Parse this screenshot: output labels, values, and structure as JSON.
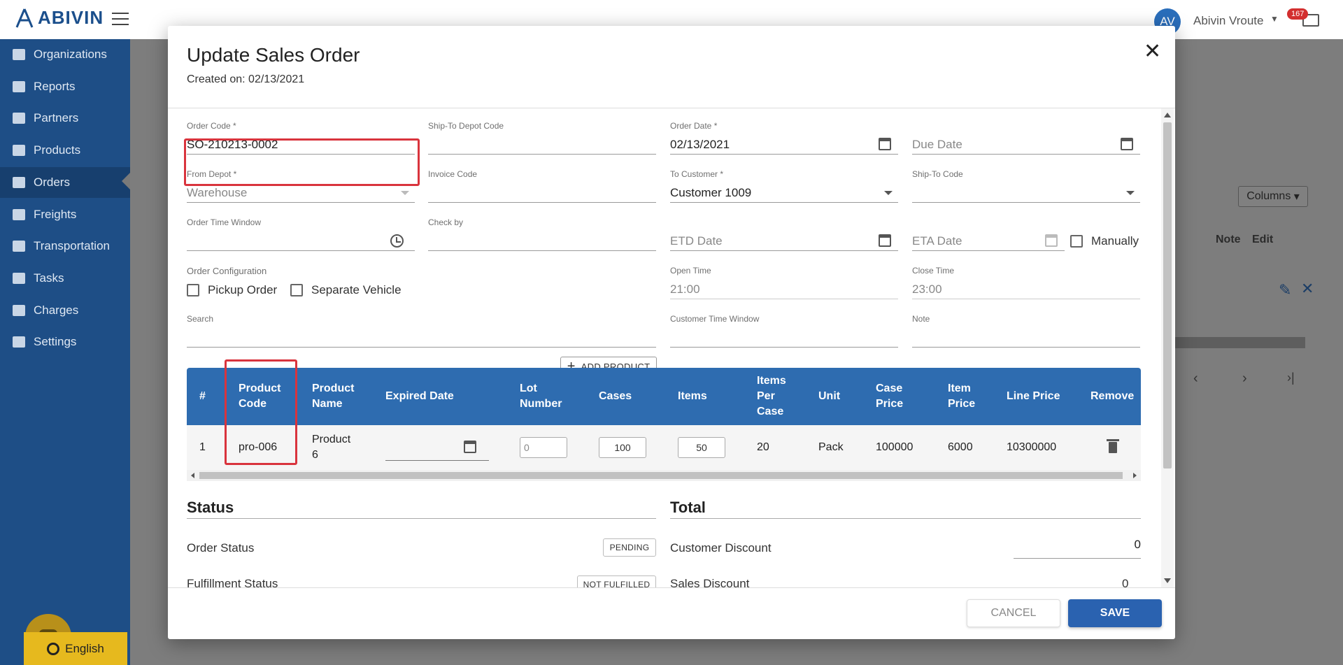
{
  "app": {
    "logo_text": "ABIVIN",
    "user_initials": "AV",
    "user_name": "Abivin Vroute",
    "notification_count": "167",
    "language": "English"
  },
  "sidebar": {
    "items": [
      {
        "label": "Organizations",
        "icon": "home-icon"
      },
      {
        "label": "Reports",
        "icon": "bar-chart-icon"
      },
      {
        "label": "Partners",
        "icon": "users-icon"
      },
      {
        "label": "Products",
        "icon": "boxes-icon"
      },
      {
        "label": "Orders",
        "icon": "cubes-icon",
        "active": true
      },
      {
        "label": "Freights",
        "icon": "truck-icon"
      },
      {
        "label": "Transportation",
        "icon": "road-icon"
      },
      {
        "label": "Tasks",
        "icon": "calendar-icon"
      },
      {
        "label": "Charges",
        "icon": "hand-coin-icon"
      },
      {
        "label": "Settings",
        "icon": "gear-icon"
      }
    ]
  },
  "background": {
    "columns_button": "Columns",
    "col_note": "Note",
    "col_edit": "Edit"
  },
  "modal": {
    "title": "Update Sales Order",
    "created_on": "Created on: 02/13/2021",
    "fields": {
      "order_code": {
        "label": "Order Code *",
        "value": "SO-210213-0002"
      },
      "ship_to_depot_code": {
        "label": "Ship-To Depot Code",
        "value": ""
      },
      "order_date": {
        "label": "Order Date *",
        "value": "02/13/2021"
      },
      "due_date": {
        "label": "",
        "placeholder": "Due Date"
      },
      "from_depot": {
        "label": "From Depot *",
        "value": "Warehouse"
      },
      "invoice_code": {
        "label": "Invoice Code",
        "value": ""
      },
      "to_customer": {
        "label": "To Customer *",
        "value": "Customer 1009"
      },
      "ship_to_code": {
        "label": "Ship-To Code",
        "value": ""
      },
      "order_time_window": {
        "label": "Order Time Window",
        "value": ""
      },
      "check_by": {
        "label": "Check by",
        "value": ""
      },
      "etd_date": {
        "label": "",
        "placeholder": "ETD Date"
      },
      "eta_date": {
        "label": "",
        "placeholder": "ETA Date"
      },
      "manually": "Manually",
      "order_configuration": "Order Configuration",
      "pickup_order": "Pickup Order",
      "separate_vehicle": "Separate Vehicle",
      "open_time": {
        "label": "Open Time",
        "value": "21:00"
      },
      "close_time": {
        "label": "Close Time",
        "value": "23:00"
      },
      "search": {
        "label": "Search",
        "value": ""
      },
      "add_product": "ADD PRODUCT",
      "customer_time_window": {
        "label": "Customer Time Window",
        "value": ""
      },
      "note": {
        "label": "Note",
        "value": ""
      }
    },
    "table": {
      "headers": {
        "num": "#",
        "product_code": [
          "Product",
          "Code"
        ],
        "product_name": [
          "Product",
          "Name"
        ],
        "expired_date": "Expired Date",
        "lot_number": [
          "Lot",
          "Number"
        ],
        "cases": "Cases",
        "items": "Items",
        "items_per_case": [
          "Items",
          "Per",
          "Case"
        ],
        "unit": "Unit",
        "case_price": [
          "Case",
          "Price"
        ],
        "item_price": [
          "Item",
          "Price"
        ],
        "line_price": "Line Price",
        "remove": "Remove"
      },
      "rows": [
        {
          "num": "1",
          "product_code": "pro-006",
          "product_name": [
            "Product",
            "6"
          ],
          "expired_date": "",
          "lot_number": "0",
          "cases": "100",
          "items": "50",
          "items_per_case": "20",
          "unit": "Pack",
          "case_price": "100000",
          "item_price": "6000",
          "line_price": "10300000"
        }
      ]
    },
    "status": {
      "title": "Status",
      "order_status_label": "Order Status",
      "order_status_value": "PENDING",
      "fulfillment_status_label": "Fulfillment Status",
      "fulfillment_status_value": "NOT FULFILLED"
    },
    "total": {
      "title": "Total",
      "customer_discount_label": "Customer Discount",
      "customer_discount_value": "0",
      "sales_discount_label": "Sales Discount",
      "sales_discount_value": "0"
    },
    "cancel": "CANCEL",
    "save": "SAVE"
  },
  "colors": {
    "sidebar_bg": "#1e4e86",
    "table_header_bg": "#2e6cb0",
    "save_button": "#2a62b0",
    "highlight_border": "#d9343d",
    "language_button": "#e6b91e"
  }
}
